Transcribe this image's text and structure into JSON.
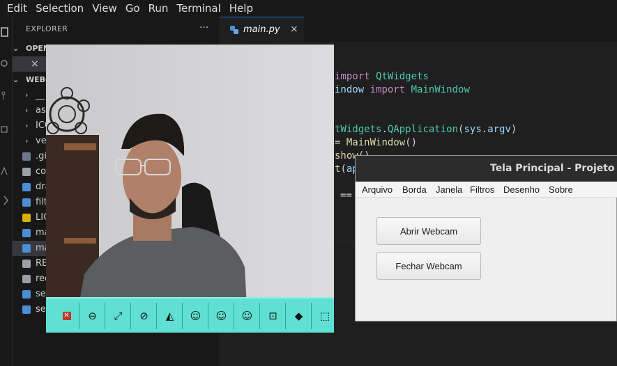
{
  "menubar": {
    "items": [
      "Edit",
      "Selection",
      "View",
      "Go",
      "Run",
      "Terminal",
      "Help"
    ]
  },
  "explorer": {
    "title": "EXPLORER",
    "more": "···",
    "open_editors_label": "OPEN",
    "open_editor_close": "×",
    "project_label": "WEBC",
    "items": [
      {
        "label": "__",
        "kind": "folder"
      },
      {
        "label": "ass",
        "kind": "folder"
      },
      {
        "label": "ICO",
        "kind": "folder"
      },
      {
        "label": "ve",
        "kind": "folder"
      },
      {
        "label": ".gi",
        "kind": "git"
      },
      {
        "label": "co",
        "kind": "text"
      },
      {
        "label": "dra",
        "kind": "python"
      },
      {
        "label": "filt",
        "kind": "python"
      },
      {
        "label": "LIC",
        "kind": "license"
      },
      {
        "label": "ma",
        "kind": "python"
      },
      {
        "label": "ma",
        "kind": "python"
      },
      {
        "label": "RE",
        "kind": "info"
      },
      {
        "label": "rec",
        "kind": "text"
      },
      {
        "label": "sec",
        "kind": "python"
      },
      {
        "label": "set",
        "kind": "python"
      }
    ]
  },
  "editor": {
    "tab_label": "main.py",
    "tab_close": "×",
    "code": {
      "l1_kw": "import",
      "l1_cls": "QtWidgets",
      "l2_cls": "indow",
      "l2_kw": "import",
      "l2_cls2": "MainWindow",
      "l3_cls": "tWidgets",
      "l3_dot": ".",
      "l3_cls2": "QApplication",
      "l3_p1": "(",
      "l3_var": "sys",
      "l3_dot2": ".",
      "l3_var2": "argv",
      "l3_p2": ")",
      "l4_op": "=",
      "l4_fn": "MainWindow",
      "l4_p": "()",
      "l5_fn": "show",
      "l5_p": "()",
      "l6_fn": "t",
      "l6_p": "(",
      "l6_var": "ap",
      "l7_op": "=="
    }
  },
  "webcam_toolbar": {
    "buttons": [
      "close-icon",
      "minus-icon",
      "expand-icon",
      "eye-off-icon",
      "flip-icon",
      "smile-icon",
      "smile-icon",
      "smile-icon",
      "lock-icon",
      "shapes-icon",
      "crop-icon"
    ]
  },
  "qt_window": {
    "title": "Tela Principal - Projeto Web",
    "menu": [
      "Arquivo",
      "Borda",
      "Janela",
      "Filtros",
      "Desenho",
      "Sobre"
    ],
    "open_button": "Abrir Webcam",
    "close_button": "Fechar Webcam"
  },
  "colors": {
    "accent": "#0078d4",
    "toolbar": "#5fe0d2",
    "editor_bg": "#1f1f1f"
  }
}
